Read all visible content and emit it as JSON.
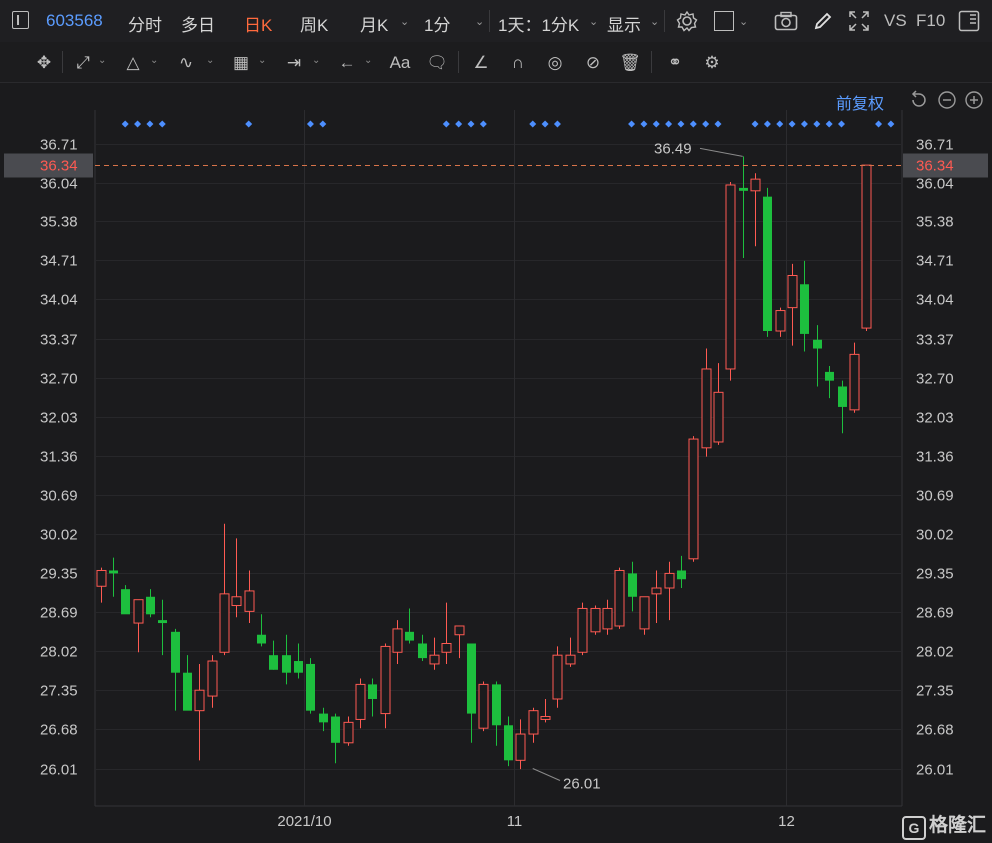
{
  "header": {
    "stock_code": "603568",
    "tabs": [
      "分时",
      "多日",
      "日K",
      "周K",
      "月K",
      "1分"
    ],
    "active_tab": "日K",
    "period_label": "1天：1分K",
    "display_label": "显示",
    "vs_label": "VS",
    "f10_label": "F10"
  },
  "toolbar": {
    "text_tool_label": "Aa",
    "icons": [
      "move-icon",
      "line-icon",
      "channel-icon",
      "wave-icon",
      "fib-icon",
      "range-icon",
      "arrow-icon",
      "text-icon",
      "comment-icon",
      "ruler-icon",
      "magnet-icon",
      "eye-icon",
      "hide-icon",
      "trash-icon",
      "overlap-icon",
      "settings-icon"
    ]
  },
  "chart_controls": {
    "adjust_label": "前复权"
  },
  "chart_data": {
    "type": "candlestick",
    "current_price": 36.34,
    "current_price_label": "36.34",
    "yticks": [
      "36.71",
      "36.04",
      "35.38",
      "34.71",
      "34.04",
      "33.37",
      "32.70",
      "32.03",
      "31.36",
      "30.69",
      "30.02",
      "29.35",
      "28.69",
      "28.02",
      "27.35",
      "26.68",
      "26.01"
    ],
    "ylim": [
      25.6,
      36.85
    ],
    "xticks": [
      {
        "label": "2021/10",
        "index": 16.5
      },
      {
        "label": "11",
        "index": 33.5
      },
      {
        "label": "12",
        "index": 55.5
      }
    ],
    "max_label": {
      "value": "36.49",
      "index": 52
    },
    "min_label": {
      "value": "26.01",
      "index": 35
    },
    "marker_indices": [
      2,
      3,
      4,
      5,
      12,
      17,
      18,
      28,
      29,
      30,
      31,
      35,
      36,
      37,
      43,
      44,
      45,
      46,
      47,
      48,
      49,
      50,
      53,
      54,
      55,
      56,
      57,
      58,
      59,
      60,
      63,
      64
    ],
    "candles": [
      {
        "o": 29.13,
        "h": 29.45,
        "l": 28.85,
        "c": 29.4
      },
      {
        "o": 29.4,
        "h": 29.62,
        "l": 28.95,
        "c": 29.35
      },
      {
        "o": 29.08,
        "h": 29.15,
        "l": 28.7,
        "c": 28.65
      },
      {
        "o": 28.5,
        "h": 28.9,
        "l": 28.0,
        "c": 28.9
      },
      {
        "o": 28.95,
        "h": 29.08,
        "l": 28.6,
        "c": 28.65
      },
      {
        "o": 28.55,
        "h": 28.9,
        "l": 27.95,
        "c": 28.5
      },
      {
        "o": 28.35,
        "h": 28.4,
        "l": 27.0,
        "c": 27.65
      },
      {
        "o": 27.65,
        "h": 27.95,
        "l": 27.05,
        "c": 27.0
      },
      {
        "o": 27.0,
        "h": 27.8,
        "l": 26.15,
        "c": 27.35
      },
      {
        "o": 27.25,
        "h": 27.95,
        "l": 27.05,
        "c": 27.85
      },
      {
        "o": 28.0,
        "h": 30.2,
        "l": 27.95,
        "c": 29.0
      },
      {
        "o": 28.8,
        "h": 29.95,
        "l": 28.6,
        "c": 28.95
      },
      {
        "o": 28.7,
        "h": 29.4,
        "l": 28.5,
        "c": 29.05
      },
      {
        "o": 28.3,
        "h": 28.65,
        "l": 28.1,
        "c": 28.15
      },
      {
        "o": 27.95,
        "h": 28.2,
        "l": 27.7,
        "c": 27.7
      },
      {
        "o": 27.95,
        "h": 28.3,
        "l": 27.45,
        "c": 27.65
      },
      {
        "o": 27.85,
        "h": 28.15,
        "l": 27.55,
        "c": 27.65
      },
      {
        "o": 27.8,
        "h": 27.9,
        "l": 26.95,
        "c": 27.0
      },
      {
        "o": 26.95,
        "h": 27.05,
        "l": 26.65,
        "c": 26.8
      },
      {
        "o": 26.9,
        "h": 26.95,
        "l": 26.1,
        "c": 26.45
      },
      {
        "o": 26.45,
        "h": 26.9,
        "l": 26.4,
        "c": 26.8
      },
      {
        "o": 26.85,
        "h": 27.55,
        "l": 26.7,
        "c": 27.45
      },
      {
        "o": 27.45,
        "h": 27.55,
        "l": 26.9,
        "c": 27.2
      },
      {
        "o": 26.95,
        "h": 28.15,
        "l": 26.7,
        "c": 28.1
      },
      {
        "o": 28.0,
        "h": 28.55,
        "l": 27.8,
        "c": 28.4
      },
      {
        "o": 28.35,
        "h": 28.75,
        "l": 28.15,
        "c": 28.2
      },
      {
        "o": 28.15,
        "h": 28.3,
        "l": 27.85,
        "c": 27.9
      },
      {
        "o": 27.8,
        "h": 28.25,
        "l": 27.7,
        "c": 27.95
      },
      {
        "o": 28.0,
        "h": 28.85,
        "l": 27.8,
        "c": 28.15
      },
      {
        "o": 28.3,
        "h": 28.45,
        "l": 27.9,
        "c": 28.45
      },
      {
        "o": 28.15,
        "h": 28.15,
        "l": 26.45,
        "c": 26.95
      },
      {
        "o": 26.7,
        "h": 27.5,
        "l": 26.65,
        "c": 27.45
      },
      {
        "o": 27.45,
        "h": 27.5,
        "l": 26.4,
        "c": 26.75
      },
      {
        "o": 26.75,
        "h": 26.9,
        "l": 26.05,
        "c": 26.15
      },
      {
        "o": 26.15,
        "h": 26.85,
        "l": 26.0,
        "c": 26.6
      },
      {
        "o": 26.6,
        "h": 27.05,
        "l": 26.45,
        "c": 27.0
      },
      {
        "o": 26.85,
        "h": 27.2,
        "l": 26.8,
        "c": 26.9
      },
      {
        "o": 27.2,
        "h": 28.1,
        "l": 27.05,
        "c": 27.95
      },
      {
        "o": 27.8,
        "h": 28.25,
        "l": 27.75,
        "c": 27.95
      },
      {
        "o": 28.0,
        "h": 28.85,
        "l": 27.95,
        "c": 28.75
      },
      {
        "o": 28.35,
        "h": 28.8,
        "l": 28.3,
        "c": 28.75
      },
      {
        "o": 28.4,
        "h": 28.9,
        "l": 28.3,
        "c": 28.75
      },
      {
        "o": 28.45,
        "h": 29.45,
        "l": 28.4,
        "c": 29.4
      },
      {
        "o": 29.35,
        "h": 29.55,
        "l": 28.7,
        "c": 28.95
      },
      {
        "o": 28.4,
        "h": 28.95,
        "l": 28.3,
        "c": 28.95
      },
      {
        "o": 29.0,
        "h": 29.4,
        "l": 28.5,
        "c": 29.1
      },
      {
        "o": 29.1,
        "h": 29.55,
        "l": 28.55,
        "c": 29.35
      },
      {
        "o": 29.4,
        "h": 29.65,
        "l": 29.1,
        "c": 29.25
      },
      {
        "o": 29.6,
        "h": 31.7,
        "l": 29.55,
        "c": 31.65
      },
      {
        "o": 31.5,
        "h": 33.2,
        "l": 31.35,
        "c": 32.85
      },
      {
        "o": 31.6,
        "h": 32.95,
        "l": 31.55,
        "c": 32.45
      },
      {
        "o": 32.85,
        "h": 36.05,
        "l": 32.65,
        "c": 36.0
      },
      {
        "o": 35.95,
        "h": 36.49,
        "l": 34.75,
        "c": 35.9
      },
      {
        "o": 35.9,
        "h": 36.2,
        "l": 34.95,
        "c": 36.1
      },
      {
        "o": 35.8,
        "h": 35.95,
        "l": 33.4,
        "c": 33.5
      },
      {
        "o": 33.5,
        "h": 33.9,
        "l": 33.4,
        "c": 33.85
      },
      {
        "o": 33.9,
        "h": 34.65,
        "l": 33.25,
        "c": 34.45
      },
      {
        "o": 34.3,
        "h": 34.7,
        "l": 33.15,
        "c": 33.45
      },
      {
        "o": 33.35,
        "h": 33.6,
        "l": 32.55,
        "c": 33.2
      },
      {
        "o": 32.8,
        "h": 32.9,
        "l": 32.35,
        "c": 32.65
      },
      {
        "o": 32.55,
        "h": 32.65,
        "l": 31.75,
        "c": 32.2
      },
      {
        "o": 32.15,
        "h": 33.3,
        "l": 32.1,
        "c": 33.1
      },
      {
        "o": 33.55,
        "h": 36.34,
        "l": 33.5,
        "c": 36.34
      }
    ]
  },
  "watermark": {
    "brand": "格隆汇"
  }
}
